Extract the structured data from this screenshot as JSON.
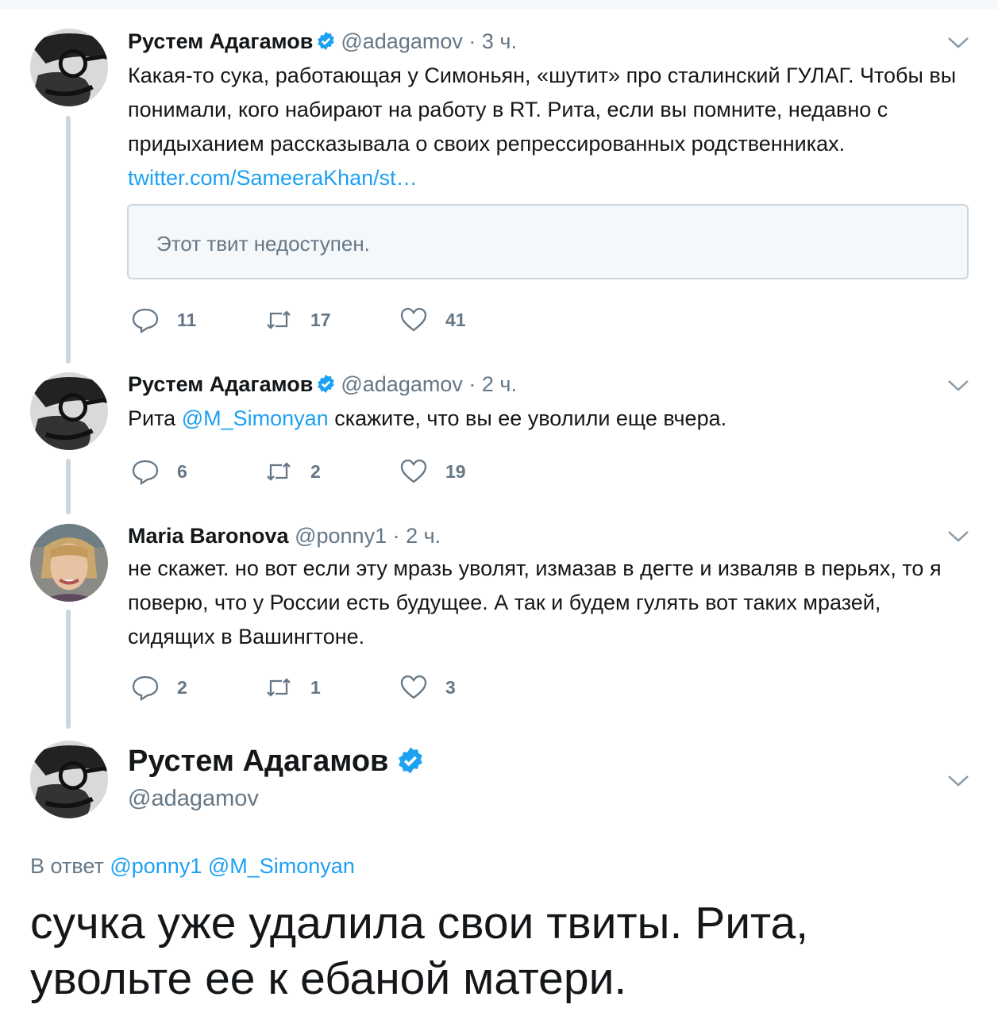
{
  "tweets": [
    {
      "name": "Рустем Адагамов",
      "handle": "@adagamov",
      "time": "· 3 ч.",
      "text": "Какая-то сука, работающая у Симоньян, «шутит» про сталинский ГУЛАГ. Чтобы вы понимали, кого набирают на работу в RT. Рита, если вы помните, недавно с придыханием рассказывала о своих репрессированных родственниках.",
      "link": "twitter.com/SameeraKhan/st…",
      "quote": "Этот твит недоступен.",
      "replies": "11",
      "retweets": "17",
      "likes": "41"
    },
    {
      "name": "Рустем Адагамов",
      "handle": "@adagamov",
      "time": "· 2 ч.",
      "text_before": "Рита",
      "mention": "@M_Simonyan",
      "text_after": "скажите, что вы ее уволили еще вчера.",
      "replies": "6",
      "retweets": "2",
      "likes": "19"
    },
    {
      "name": "Maria Baronova",
      "handle": "@ponny1",
      "time": "· 2 ч.",
      "text": "не скажет. но вот если эту мразь уволят, измазав в дегте и изваляв в перьях, то я поверю, что у России есть будущее. А так и будем гулять вот таких мразей, сидящих в Вашингтоне.",
      "replies": "2",
      "retweets": "1",
      "likes": "3"
    }
  ],
  "main_tweet": {
    "name": "Рустем Адагамов",
    "handle": "@adagamov",
    "reply_prefix": "В ответ",
    "reply_mention_1": "@ponny1",
    "reply_mention_2": "@M_Simonyan",
    "text": "сучка уже удалила свои твиты. Рита, увольте ее к ебаной матери."
  },
  "colors": {
    "link": "#1da1f2",
    "muted": "#657786",
    "thread_line": "#ccd6dd",
    "verified": "#1da1f2"
  },
  "icons": [
    "reply-icon",
    "retweet-icon",
    "like-icon",
    "verified-icon",
    "chevron-down-icon"
  ]
}
